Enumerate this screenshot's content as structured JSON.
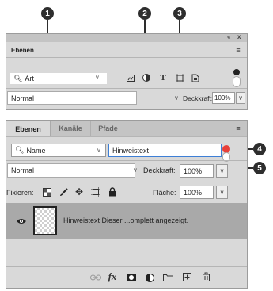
{
  "callouts": [
    "1",
    "2",
    "3",
    "4",
    "5"
  ],
  "top_panel": {
    "window_controls": {
      "collapse": "«",
      "close": "x"
    },
    "title": "Ebenen",
    "menu_icon": "menu-icon",
    "filter_kind": "Art",
    "filter_icons": [
      "image-filter-icon",
      "adjustment-filter-icon",
      "text-filter-icon",
      "shape-filter-icon",
      "smartobject-filter-icon"
    ],
    "blend_mode": "Normal",
    "opacity_label": "Deckkraft:",
    "opacity_value": "100%"
  },
  "bottom_panel": {
    "tabs": [
      "Ebenen",
      "Kanäle",
      "Pfade"
    ],
    "filter_kind": "Name",
    "filter_text": "Hinweistext",
    "blend_mode": "Normal",
    "opacity_label": "Deckkraft:",
    "opacity_value": "100%",
    "lock_label": "Fixieren:",
    "fill_label": "Fläche:",
    "fill_value": "100%",
    "layer": {
      "name": "Hinweistext Dieser ...omplett angezeigt."
    },
    "footer_icons": [
      "link-icon",
      "fx-icon",
      "mask-icon",
      "adjustment-icon",
      "folder-icon",
      "new-layer-icon",
      "trash-icon"
    ],
    "fx_label": "fx"
  },
  "colors": {
    "accent_red": "#e8403a",
    "focus_blue": "#3d7fd6",
    "callout": "#2e2e2e"
  }
}
